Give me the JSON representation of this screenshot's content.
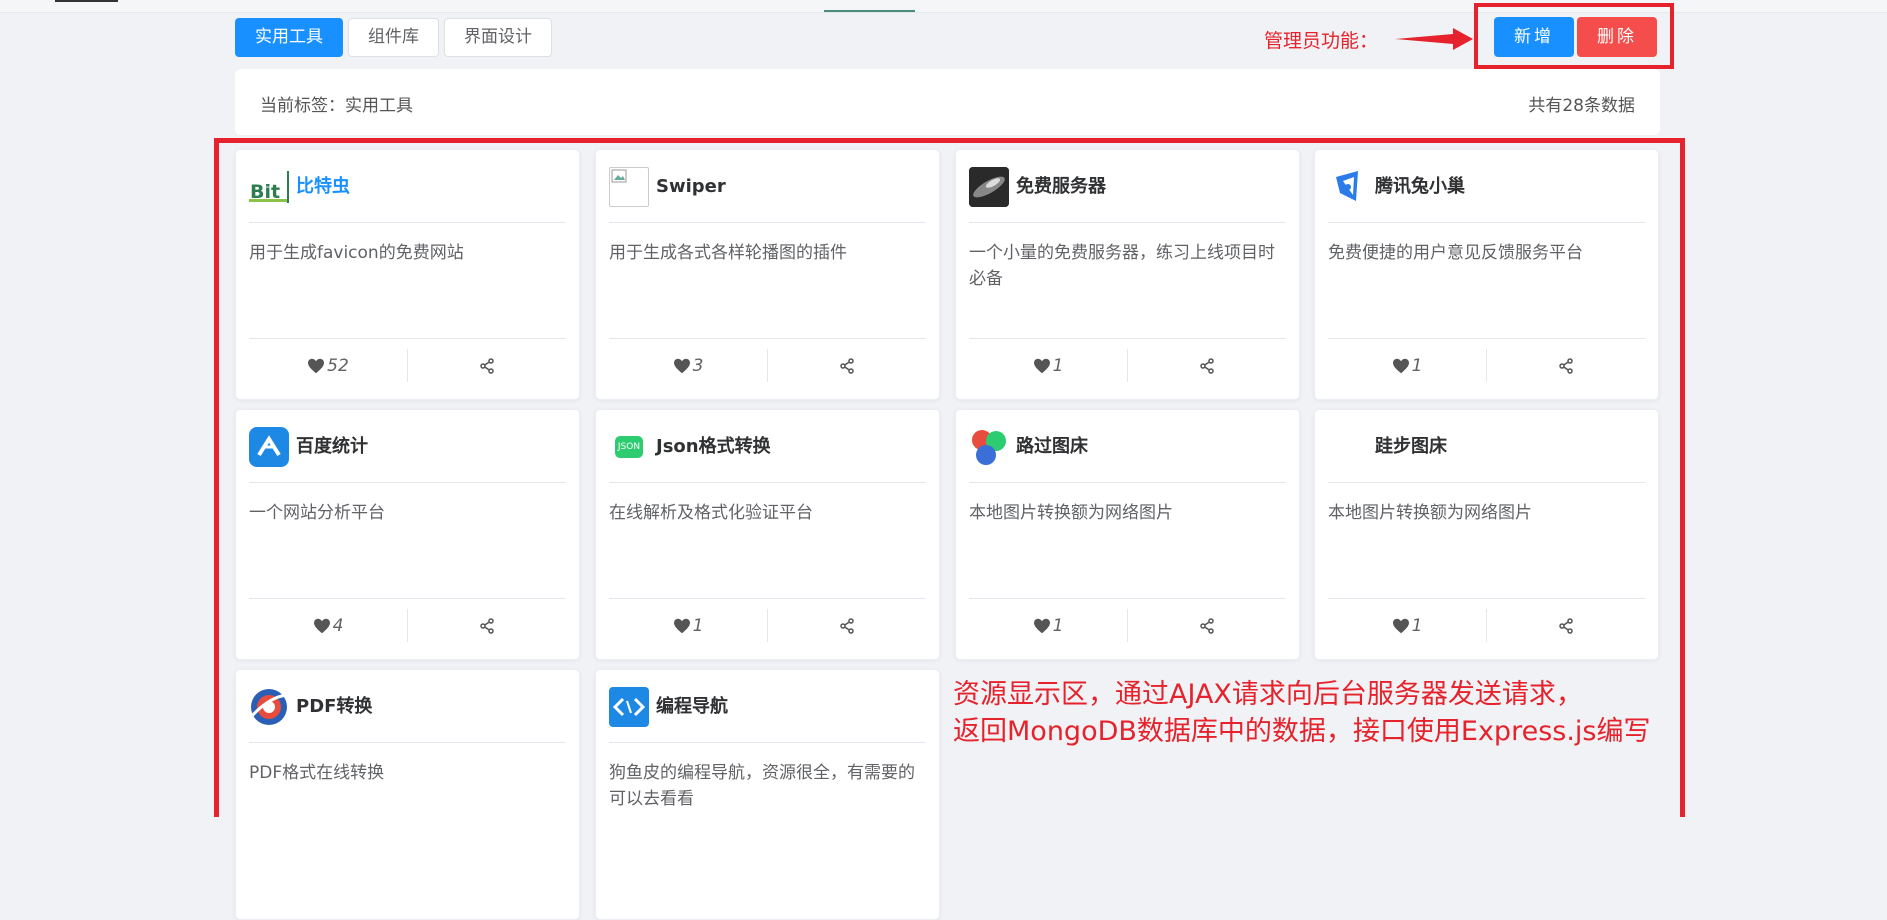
{
  "tabs": [
    {
      "label": "实用工具",
      "active": true
    },
    {
      "label": "组件库",
      "active": false
    },
    {
      "label": "界面设计",
      "active": false
    }
  ],
  "admin": {
    "note": "管理员功能：",
    "add_label": "新增",
    "delete_label": "删除"
  },
  "info": {
    "current_tag": "当前标签：实用工具",
    "total": "共有28条数据"
  },
  "cards": [
    {
      "name": "比特虫",
      "desc": "用于生成favicon的免费网站",
      "likes": "52",
      "logo": "bitbug-logo"
    },
    {
      "name": "Swiper",
      "desc": "用于生成各式各样轮播图的插件",
      "likes": "3",
      "logo": "broken-image"
    },
    {
      "name": "免费服务器",
      "desc": "一个小量的免费服务器，练习上线项目时必备",
      "likes": "1",
      "logo": "server-photo"
    },
    {
      "name": "腾讯兔小巢",
      "desc": "免费便捷的用户意见反馈服务平台",
      "likes": "1",
      "logo": "txc-logo"
    },
    {
      "name": "百度统计",
      "desc": "一个网站分析平台",
      "likes": "4",
      "logo": "baidu-tongji-logo"
    },
    {
      "name": "Json格式转换",
      "desc": "在线解析及格式化验证平台",
      "likes": "1",
      "logo": "json-logo",
      "logo_text": "JSON"
    },
    {
      "name": "路过图床",
      "desc": "本地图片转换额为网络图片",
      "likes": "1",
      "logo": "imgchr-logo"
    },
    {
      "name": "跬步图床",
      "desc": "本地图片转换额为网络图片",
      "likes": "1",
      "logo": "blank"
    },
    {
      "name": "PDF转换",
      "desc": "PDF格式在线转换",
      "likes": "",
      "logo": "pdf-logo"
    },
    {
      "name": "编程导航",
      "desc": "狗鱼皮的编程导航，资源很全，有需要的可以去看看",
      "likes": "",
      "logo": "code-nav-logo"
    }
  ],
  "annotation": {
    "line1": "资源显示区，通过AJAX请求向后台服务器发送请求，",
    "line2": "返回MongoDB数据库中的数据，接口使用Express.js编写"
  },
  "colors": {
    "primary": "#1890ff",
    "danger": "#f54c4c",
    "annotation_red": "#e6232c"
  }
}
